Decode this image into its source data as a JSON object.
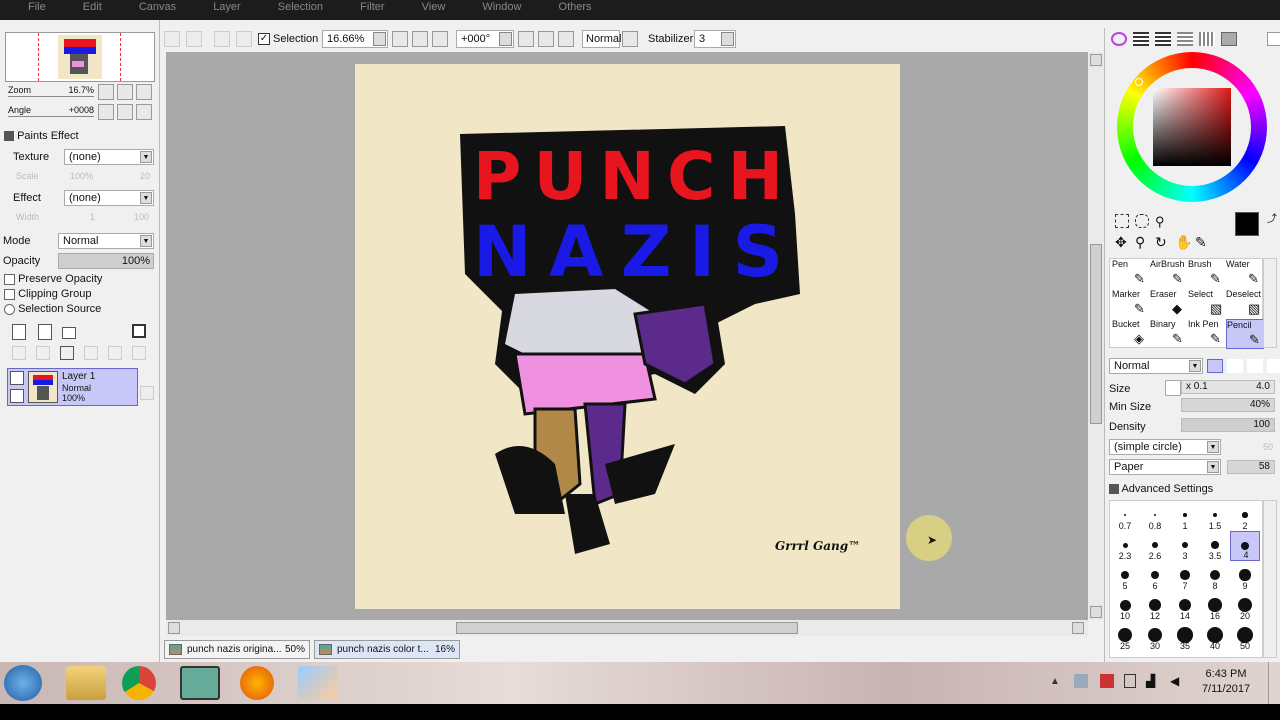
{
  "menubar": {
    "items": [
      "File",
      "Edit",
      "Canvas",
      "Layer",
      "Selection",
      "Filter",
      "View",
      "Window",
      "Others"
    ]
  },
  "navigator": {
    "zoom_label": "Zoom",
    "zoom_value": "16.7%",
    "angle_label": "Angle",
    "angle_value": "+0008"
  },
  "paints_effect": {
    "title": "Paints Effect",
    "texture_label": "Texture",
    "texture_value": "(none)",
    "scale_label": "Scale",
    "scale_value": "100%",
    "scale_num": "20",
    "effect_label": "Effect",
    "effect_value": "(none)",
    "width_label": "Width",
    "width_value": "1",
    "width_num": "100"
  },
  "layer_props": {
    "mode_label": "Mode",
    "mode_value": "Normal",
    "opacity_label": "Opacity",
    "opacity_value": "100%",
    "preserve_opacity": "Preserve Opacity",
    "clipping_group": "Clipping Group",
    "selection_source": "Selection Source"
  },
  "layers": [
    {
      "name": "Layer 1",
      "mode": "Normal",
      "opacity": "100%"
    }
  ],
  "toolbar": {
    "selection_label": "Selection",
    "zoom_value": "16.66%",
    "rotation_value": "+000°",
    "blend_value": "Normal",
    "stabilizer_label": "Stabilizer",
    "stabilizer_value": "3"
  },
  "canvas": {
    "art_line1": "PUNCH",
    "art_line2": "NAZIS",
    "signature": "Grrrl Gang™",
    "colors": {
      "paper": "#f1e6c5",
      "red": "#e8141e",
      "blue": "#1a1ae6",
      "pink": "#f090e0",
      "purple": "#5b2a8a",
      "tan": "#b08848"
    }
  },
  "tools": {
    "row1": [
      "Pen",
      "AirBrush",
      "Brush",
      "Water"
    ],
    "row2": [
      "Marker",
      "Eraser",
      "Select",
      "Deselect"
    ],
    "row3": [
      "Bucket",
      "Binary",
      "Ink Pen",
      "Pencil"
    ],
    "selected": "Pencil"
  },
  "brush_settings": {
    "blend_value": "Normal",
    "size_label": "Size",
    "size_mult": "x 0.1",
    "size_value": "4.0",
    "minsize_label": "Min Size",
    "minsize_value": "40%",
    "density_label": "Density",
    "density_value": "100",
    "shape_value": "(simple circle)",
    "shape_num": "50",
    "texture_value": "Paper",
    "texture_num": "58",
    "advanced_label": "Advanced Settings"
  },
  "brush_sizes": [
    "0.7",
    "0.8",
    "1",
    "1.5",
    "2",
    "2.3",
    "2.6",
    "3",
    "3.5",
    "4",
    "5",
    "6",
    "7",
    "8",
    "9",
    "10",
    "12",
    "14",
    "16",
    "20",
    "25",
    "30",
    "35",
    "40",
    "50"
  ],
  "doc_tabs": [
    {
      "name": "punch nazis origina...",
      "zoom": "50%"
    },
    {
      "name": "punch nazis color t...",
      "zoom": "16%"
    }
  ],
  "tray": {
    "time": "6:43 PM",
    "date": "7/11/2017"
  }
}
